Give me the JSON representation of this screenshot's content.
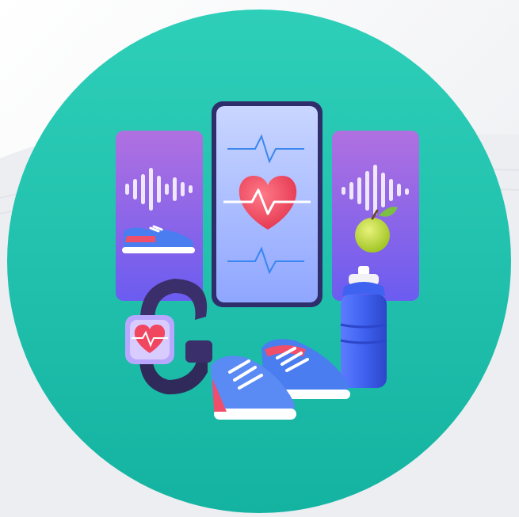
{
  "colors": {
    "background": "#f4f5f7",
    "circle_top": "#2ecfb9",
    "circle_bottom": "#14b3a1",
    "card_purple_top": "#b070e0",
    "card_purple_bottom": "#6b5cf0",
    "phone_screen_top": "#c9d6ff",
    "phone_screen_bottom": "#8fa6ff",
    "heart": "#f0465f",
    "shoe_blue": "#4a7df0",
    "shoe_red": "#ef4f6a",
    "bottle_blue": "#3f62f0",
    "watch_band": "#3b2f6b",
    "apple": "#b9d33a"
  },
  "icons": [
    "fitness-circle-backdrop",
    "sound-wave-card-icon",
    "sneaker-icon",
    "smartphone-icon",
    "heart-rate-icon",
    "pulse-line-icon",
    "apple-icon",
    "water-bottle-icon",
    "smartwatch-icon",
    "sneakers-pair-icon"
  ]
}
